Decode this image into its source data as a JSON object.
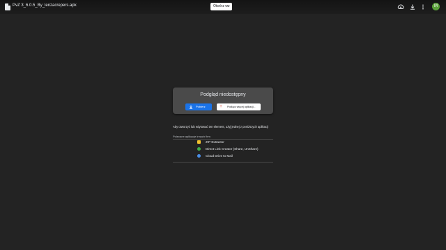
{
  "header": {
    "filename": "PvZ 3_6.0.5_By_lenzacrepers.apk",
    "open_with_label": "Otwórz w",
    "avatar_letter": "M"
  },
  "preview": {
    "title": "Podgląd niedostępny",
    "download_label": "Pobierz",
    "connect_label": "Podłącz więcej aplikacji..."
  },
  "hint": "Aby otworzyć lub edytować ten element, użyj jednej z poniższych aplikacji",
  "recommended": {
    "header": "Polecane aplikacje innych firm",
    "apps": [
      {
        "name": "ZIP Extractor",
        "icon": "zip-extractor-icon",
        "color": "#f2c12e"
      },
      {
        "name": "Direct Link Creator (Share, UnShare)",
        "icon": "direct-link-icon",
        "color": "#3fae49"
      },
      {
        "name": "Cloud Drive to Mail",
        "icon": "cloud-drive-mail-icon",
        "color": "#4a8fe7"
      }
    ]
  },
  "colors": {
    "background": "#232323",
    "card": "#4a4a4a",
    "primary": "#1a73e8",
    "avatar": "#5aa03a"
  }
}
